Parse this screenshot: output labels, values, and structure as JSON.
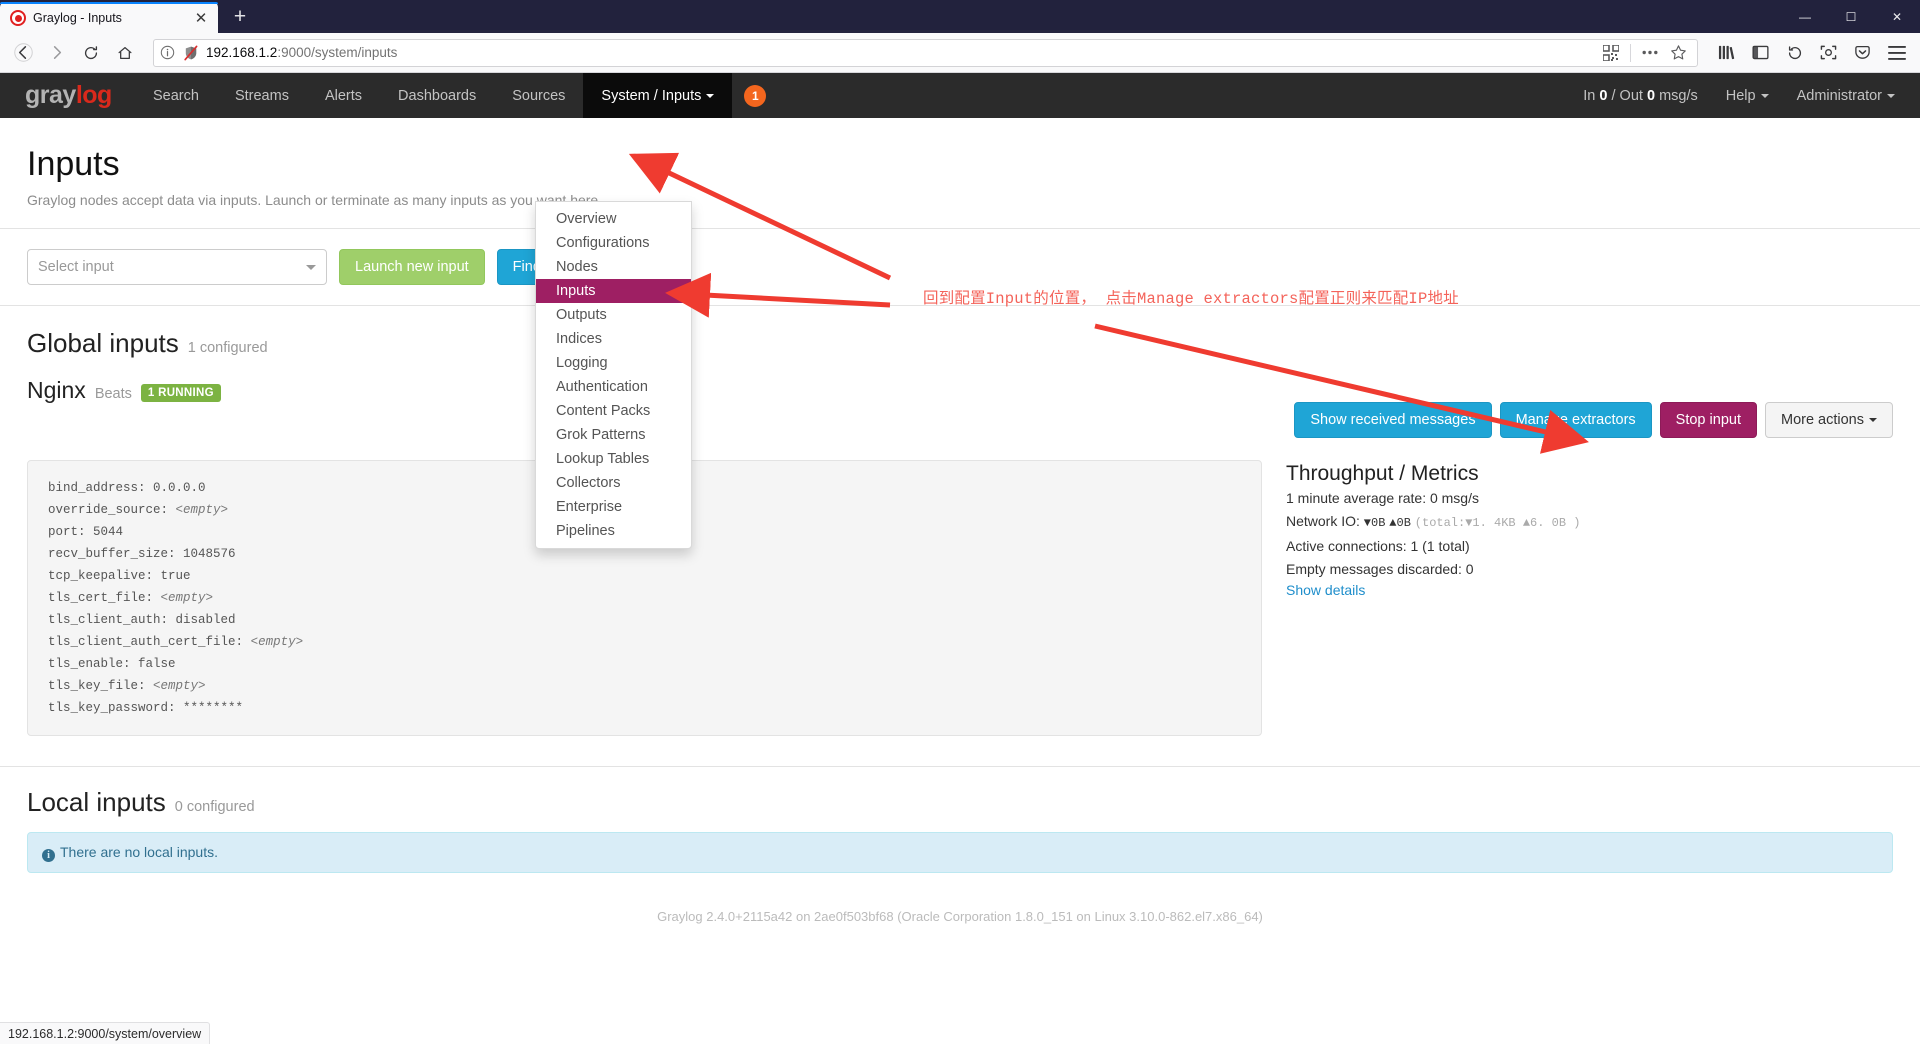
{
  "browser": {
    "tab_title": "Graylog - Inputs",
    "new_tab_label": "+",
    "close_tab_label": "✕",
    "window_controls": {
      "minimize": "—",
      "maximize": "☐",
      "close": "✕"
    },
    "url": {
      "host": "192.168.1.2",
      "rest": ":9000/system/inputs"
    },
    "status_bar": "192.168.1.2:9000/system/overview"
  },
  "navbar": {
    "logo": {
      "gray": "gray",
      "log": "log"
    },
    "items": [
      {
        "label": "Search",
        "active": false
      },
      {
        "label": "Streams",
        "active": false
      },
      {
        "label": "Alerts",
        "active": false
      },
      {
        "label": "Dashboards",
        "active": false
      },
      {
        "label": "Sources",
        "active": false
      },
      {
        "label": "System / Inputs",
        "active": true
      }
    ],
    "badge_count": "1",
    "throughput": {
      "prefix": "In ",
      "in": "0",
      "middle": " / Out ",
      "out": "0",
      "suffix": " msg/s"
    },
    "help_label": "Help",
    "user_label": "Administrator"
  },
  "dropdown": {
    "items": [
      {
        "label": "Overview",
        "selected": false
      },
      {
        "label": "Configurations",
        "selected": false
      },
      {
        "label": "Nodes",
        "selected": false
      },
      {
        "label": "Inputs",
        "selected": true
      },
      {
        "label": "Outputs",
        "selected": false
      },
      {
        "label": "Indices",
        "selected": false
      },
      {
        "label": "Logging",
        "selected": false
      },
      {
        "label": "Authentication",
        "selected": false
      },
      {
        "label": "Content Packs",
        "selected": false
      },
      {
        "label": "Grok Patterns",
        "selected": false
      },
      {
        "label": "Lookup Tables",
        "selected": false
      },
      {
        "label": "Collectors",
        "selected": false
      },
      {
        "label": "Enterprise",
        "selected": false
      },
      {
        "label": "Pipelines",
        "selected": false
      }
    ]
  },
  "page": {
    "title": "Inputs",
    "description": "Graylog nodes accept data via inputs. Launch or terminate as many inputs as you want here.",
    "select_placeholder": "Select input",
    "launch_button": "Launch new input",
    "find_button": "Find more inputs"
  },
  "global_inputs": {
    "heading": "Global inputs",
    "count_label": "1 configured",
    "input": {
      "name": "Nginx",
      "type": "Beats",
      "status_label": "1 RUNNING",
      "config": [
        {
          "key": "bind_address:",
          "value": "0.0.0.0",
          "italic": false
        },
        {
          "key": "override_source:",
          "value": "<empty>",
          "italic": true
        },
        {
          "key": "port:",
          "value": "5044",
          "italic": false
        },
        {
          "key": "recv_buffer_size:",
          "value": "1048576",
          "italic": false
        },
        {
          "key": "tcp_keepalive:",
          "value": "true",
          "italic": false
        },
        {
          "key": "tls_cert_file:",
          "value": "<empty>",
          "italic": true
        },
        {
          "key": "tls_client_auth:",
          "value": "disabled",
          "italic": false
        },
        {
          "key": "tls_client_auth_cert_file:",
          "value": "<empty>",
          "italic": true
        },
        {
          "key": "tls_enable:",
          "value": "false",
          "italic": false
        },
        {
          "key": "tls_key_file:",
          "value": "<empty>",
          "italic": true
        },
        {
          "key": "tls_key_password:",
          "value": "********",
          "italic": false
        }
      ],
      "actions": [
        {
          "label": "Show received messages",
          "style": "blue"
        },
        {
          "label": "Manage extractors",
          "style": "blue"
        },
        {
          "label": "Stop input",
          "style": "magenta"
        },
        {
          "label": "More actions",
          "style": "default",
          "caret": true
        }
      ],
      "metrics": {
        "heading": "Throughput / Metrics",
        "rate": "1 minute average rate: 0 msg/s",
        "network_io_label": "Network IO:",
        "network_io_down": "▼0B",
        "network_io_up": "▲0B",
        "network_io_total": "(total:▼1. 4KB ▲6. 0B )",
        "active_connections": "Active connections: 1 (1 total)",
        "empty_discarded": "Empty messages discarded: 0",
        "show_details": "Show details"
      }
    }
  },
  "local_inputs": {
    "heading": "Local inputs",
    "count_label": "0 configured",
    "empty_message": "There are no local inputs."
  },
  "footer": {
    "text": "Graylog 2.4.0+2115a42 on 2ae0f503bf68 (Oracle Corporation 1.8.0_151 on Linux 3.10.0-862.el7.x86_64)"
  },
  "annotations": {
    "note": "回到配置Input的位置， 点击Manage extractors配置正则来匹配IP地址"
  },
  "colors": {
    "accent_blue": "#1fa5d6",
    "accent_magenta": "#9e1f63",
    "accent_green": "#9fcf6a",
    "running_green": "#7cb342",
    "badge_orange": "#f4661e",
    "annotation_red": "#f4635a"
  }
}
